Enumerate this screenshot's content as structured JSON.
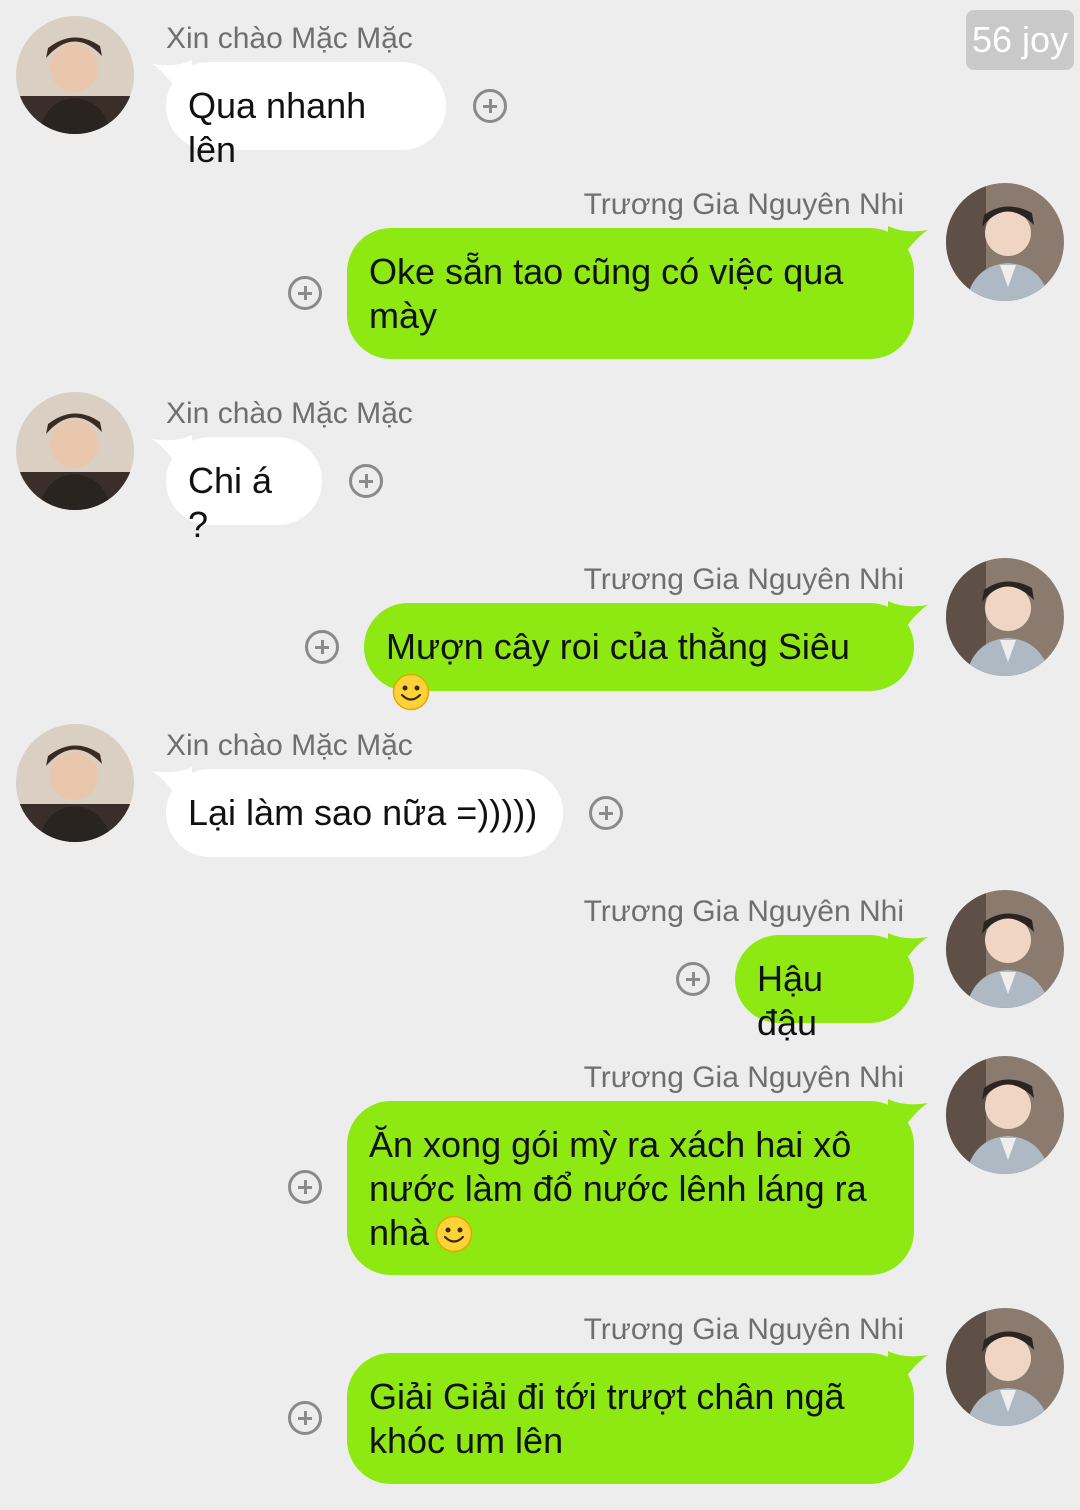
{
  "watermark": "56 joy",
  "contacts": {
    "other": "Xin chào Mặc Mặc",
    "me": "Trương Gia Nguyên Nhi"
  },
  "messages": [
    {
      "sender": "Xin chào Mặc Mặc",
      "text": "Qua nhanh lên"
    },
    {
      "sender": "Trương Gia Nguyên Nhi",
      "text": "Oke sẵn tao cũng có việc qua\nmày"
    },
    {
      "sender": "Xin chào Mặc Mặc",
      "text": "Chi á ?"
    },
    {
      "sender": "Trương Gia Nguyên Nhi",
      "text": "Mượn cây roi của thằng Siêu"
    },
    {
      "sender": "Xin chào Mặc Mặc",
      "text": "Lại làm sao nữa =)))))"
    },
    {
      "sender": "Trương Gia Nguyên Nhi",
      "text": "Hậu đậu"
    },
    {
      "sender": "Trương Gia Nguyên Nhi",
      "text": "Ăn xong gói mỳ ra xách hai xô\nnước làm đổ nước lênh láng ra\nnhà"
    },
    {
      "sender": "Trương Gia Nguyên Nhi",
      "text": "Giải Giải đi tới trượt chân ngã\nkhóc um lên"
    }
  ],
  "colors": {
    "background": "#ededed",
    "outgoing_bubble": "#8ee812",
    "incoming_bubble": "#ffffff"
  },
  "icons": [
    "add-reaction-icon",
    "smiley-emoji-icon",
    "avatar-photo"
  ]
}
